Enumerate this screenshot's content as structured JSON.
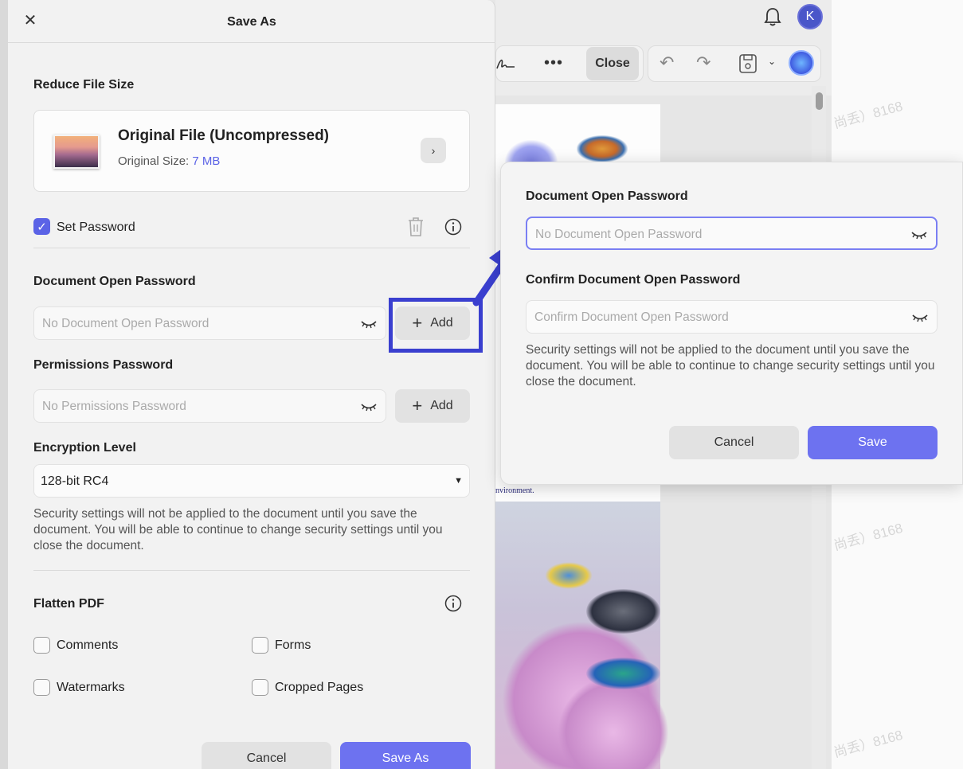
{
  "save_as": {
    "title": "Save As",
    "close_glyph": "✕",
    "reduce_size_label": "Reduce File Size",
    "file": {
      "name": "Original File (Uncompressed)",
      "size_label": "Original Size: ",
      "size_value": "7 MB"
    },
    "set_password_label": "Set Password",
    "set_password_checked": true,
    "doc_open_label": "Document Open Password",
    "doc_open_placeholder": "No Document Open Password",
    "add_label": "Add",
    "permissions_label": "Permissions Password",
    "permissions_placeholder": "No Permissions Password",
    "encryption_label": "Encryption Level",
    "encryption_value": "128-bit RC4",
    "note": "Security settings will not be applied to the document until you save the document. You will be able to continue to change security settings until you close the document.",
    "flatten_label": "Flatten PDF",
    "flatten_options": {
      "comments": "Comments",
      "forms": "Forms",
      "watermarks": "Watermarks",
      "cropped_pages": "Cropped Pages"
    },
    "cancel_label": "Cancel",
    "save_as_label": "Save As"
  },
  "popup": {
    "doc_open_label": "Document Open Password",
    "doc_open_placeholder": "No Document Open Password",
    "confirm_label": "Confirm Document Open Password",
    "confirm_placeholder": "Confirm Document Open Password",
    "note": "Security settings will not be applied to the document until you save the document. You will be able to continue to change security settings until you close the document.",
    "cancel_label": "Cancel",
    "save_label": "Save"
  },
  "background": {
    "close_label": "Close",
    "avatar_initial": "K",
    "doc_snippet": "nvironment."
  },
  "colors": {
    "accent": "#6d72f0",
    "highlight": "#3a3fcf",
    "link": "#5b63e6"
  }
}
